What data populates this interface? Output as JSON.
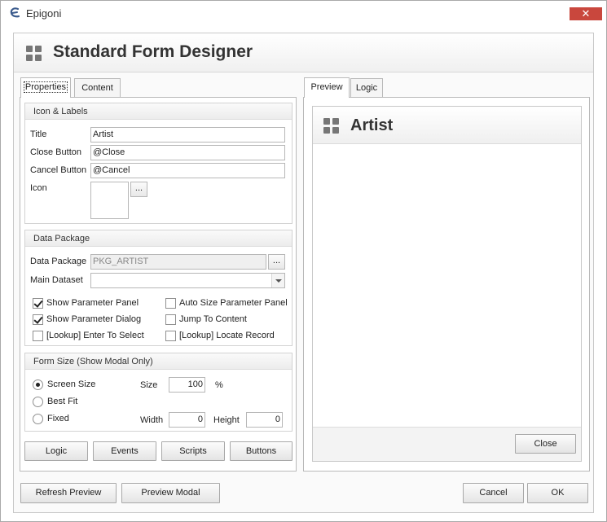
{
  "window": {
    "title": "Epigoni",
    "close_glyph": "✕",
    "logo_icon": "epigoni-logo-icon"
  },
  "header": {
    "title": "Standard Form Designer",
    "icon": "grid-icon"
  },
  "left_tabs": [
    {
      "label": "Properties",
      "active": true
    },
    {
      "label": "Content",
      "active": false
    }
  ],
  "icon_labels": {
    "header": "Icon & Labels",
    "title_label": "Title",
    "title_value": "Artist",
    "close_label": "Close Button",
    "close_value": "@Close",
    "cancel_label": "Cancel Button",
    "cancel_value": "@Cancel",
    "icon_label": "Icon",
    "browse_glyph": "..."
  },
  "data_package": {
    "header": "Data Package",
    "package_label": "Data Package",
    "package_value": "PKG_ARTIST",
    "browse_glyph": "...",
    "dataset_label": "Main Dataset",
    "dataset_value": "",
    "checkboxes": [
      {
        "label": "Show Parameter Panel",
        "checked": true
      },
      {
        "label": "Auto Size Parameter Panel",
        "checked": false
      },
      {
        "label": "Show Parameter Dialog",
        "checked": true
      },
      {
        "label": "Jump To Content",
        "checked": false
      },
      {
        "label": "[Lookup] Enter To Select",
        "checked": false
      },
      {
        "label": "[Lookup] Locate Record",
        "checked": false
      }
    ]
  },
  "form_size": {
    "header": "Form Size (Show Modal Only)",
    "radios": [
      {
        "label": "Screen Size",
        "selected": true
      },
      {
        "label": "Best Fit",
        "selected": false
      },
      {
        "label": "Fixed",
        "selected": false
      }
    ],
    "size_label": "Size",
    "size_value": "100",
    "size_unit": "%",
    "width_label": "Width",
    "width_value": "0",
    "height_label": "Height",
    "height_value": "0"
  },
  "left_buttons": {
    "logic": "Logic",
    "events": "Events",
    "scripts": "Scripts",
    "buttons": "Buttons"
  },
  "right_tabs": [
    {
      "label": "Preview",
      "active": true
    },
    {
      "label": "Logic",
      "active": false
    }
  ],
  "preview": {
    "title": "Artist",
    "close_button": "Close"
  },
  "footer": {
    "refresh": "Refresh Preview",
    "preview_modal": "Preview Modal",
    "cancel": "Cancel",
    "ok": "OK"
  }
}
